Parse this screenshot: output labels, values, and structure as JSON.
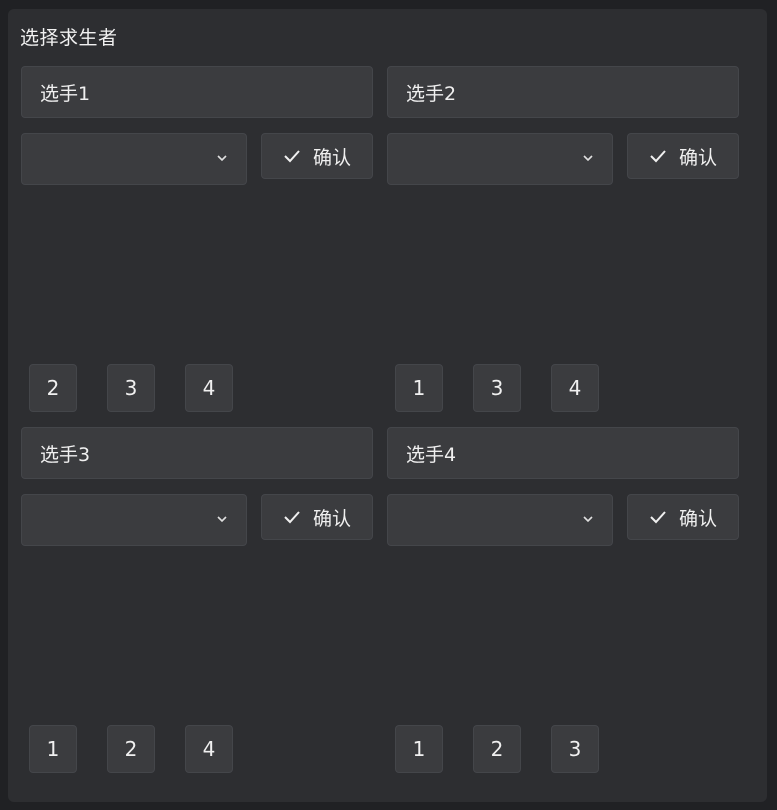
{
  "panel": {
    "title": "选择求生者"
  },
  "players": [
    {
      "name": "选手1",
      "select_value": "",
      "confirm_label": "确认",
      "numbers": [
        "2",
        "3",
        "4"
      ]
    },
    {
      "name": "选手2",
      "select_value": "",
      "confirm_label": "确认",
      "numbers": [
        "1",
        "3",
        "4"
      ]
    },
    {
      "name": "选手3",
      "select_value": "",
      "confirm_label": "确认",
      "numbers": [
        "1",
        "2",
        "4"
      ]
    },
    {
      "name": "选手4",
      "select_value": "",
      "confirm_label": "确认",
      "numbers": [
        "1",
        "2",
        "3"
      ]
    }
  ],
  "icons": {
    "chevron": "chevron-down-icon",
    "check": "check-icon"
  },
  "colors": {
    "background": "#202124",
    "panel": "#2d2e31",
    "control": "#3b3c3f",
    "border": "#44464a",
    "text": "#f0f0f0"
  }
}
